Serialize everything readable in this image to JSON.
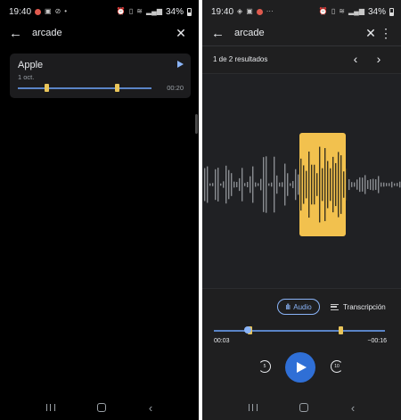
{
  "colors": {
    "accent_blue": "#8ab4f8",
    "play_blue": "#2f6fd6",
    "highlight_yellow": "#f2c14e",
    "background_dark": "#202124"
  },
  "left_screen": {
    "status_bar": {
      "time": "19:40",
      "battery": "34%"
    },
    "top_bar": {
      "back_icon": "arrow-left-icon",
      "query": "arcade",
      "close_icon": "close-icon"
    },
    "recording": {
      "title": "Apple",
      "date": "1 oct.",
      "duration": "00:20",
      "match_positions": [
        0.21,
        0.74
      ]
    },
    "nav_bar": [
      "recent-apps-icon",
      "home-icon",
      "back-icon"
    ]
  },
  "right_screen": {
    "status_bar": {
      "time": "19:40",
      "battery": "34%"
    },
    "top_bar": {
      "back_icon": "arrow-left-icon",
      "query": "arcade",
      "close_icon": "close-icon",
      "more_icon": "more-vert-icon"
    },
    "results": {
      "text": "1 de 2 resultados",
      "prev_icon": "chevron-left-icon",
      "next_icon": "chevron-right-icon"
    },
    "tabs": {
      "audio": "Audio",
      "transcription": "Transcripción"
    },
    "player": {
      "elapsed": "00:03",
      "remaining": "−00:16",
      "progress": 0.2,
      "match_positions": [
        0.21,
        0.74
      ],
      "rewind_label": "5",
      "forward_label": "10"
    },
    "nav_bar": [
      "recent-apps-icon",
      "home-icon",
      "back-icon"
    ]
  }
}
